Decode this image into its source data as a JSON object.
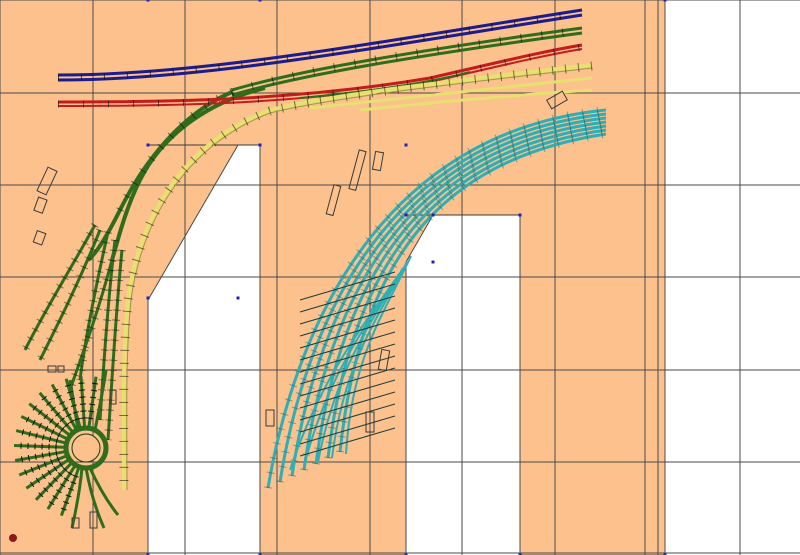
{
  "layout_editor": {
    "canvas_description": "",
    "colors": {
      "background": "#ffffff",
      "baseboard": "#fcc18c",
      "grid": "#4a4a4a",
      "ruler_marks": "#2020c0",
      "track_blue": "#1c1c8c",
      "track_green": "#2f6d1c",
      "track_red": "#c41c1c",
      "track_yellow": "#e8e070",
      "track_cyan": "#2eaeb6",
      "sleepers": "#202020",
      "structures": "#3a3a3a",
      "marker_dot": "#8b1a1a"
    },
    "grid": {
      "columns": 9,
      "rows": 6
    },
    "track_colors": [
      "blue",
      "green",
      "red",
      "yellow",
      "cyan"
    ]
  }
}
